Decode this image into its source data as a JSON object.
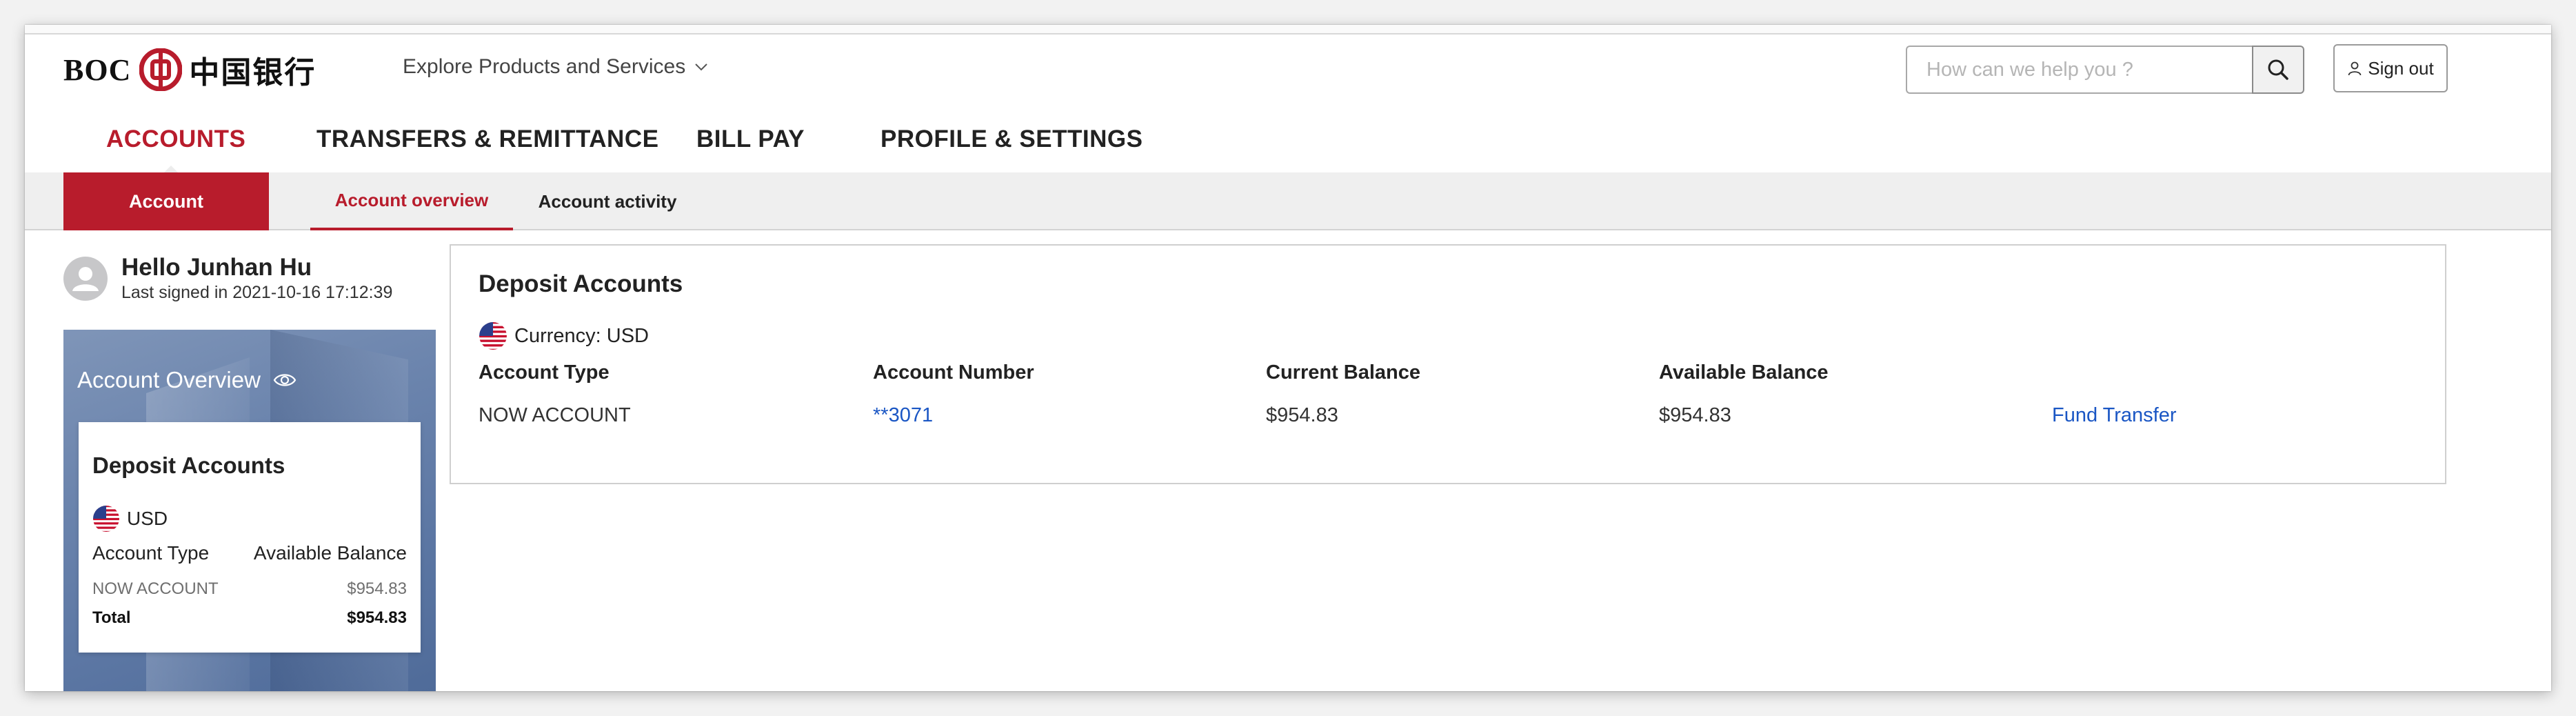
{
  "brand": {
    "name": "BOC",
    "name_cn": "中国银行",
    "accent": "#b81c2c",
    "link_color": "#1a56c4"
  },
  "header": {
    "explore_label": "Explore Products and Services",
    "search_placeholder": "How can we help you ?",
    "signout_label": "Sign out"
  },
  "mainnav": {
    "items": [
      {
        "label": "ACCOUNTS",
        "active": true
      },
      {
        "label": "TRANSFERS & REMITTANCE"
      },
      {
        "label": "BILL PAY"
      },
      {
        "label": "PROFILE & SETTINGS"
      }
    ]
  },
  "subnav": {
    "section": "Account",
    "tabs": [
      {
        "label": "Account overview",
        "active": true
      },
      {
        "label": "Account activity"
      }
    ]
  },
  "user": {
    "greeting": "Hello Junhan Hu",
    "last_signed": "Last signed in 2021-10-16 17:12:39"
  },
  "overview": {
    "title": "Account Overview",
    "card_title": "Deposit Accounts",
    "currency": "USD",
    "col_type": "Account Type",
    "col_balance": "Available Balance",
    "row_type": "NOW ACCOUNT",
    "row_balance": "$954.83",
    "total_label": "Total",
    "total_value": "$954.83"
  },
  "deposit": {
    "title": "Deposit Accounts",
    "currency_label": "Currency: USD",
    "headers": [
      "Account Type",
      "Account Number",
      "Current Balance",
      "Available Balance"
    ],
    "row": {
      "type": "NOW ACCOUNT",
      "number": "**3071",
      "current": "$954.83",
      "available": "$954.83",
      "action": "Fund Transfer"
    }
  }
}
